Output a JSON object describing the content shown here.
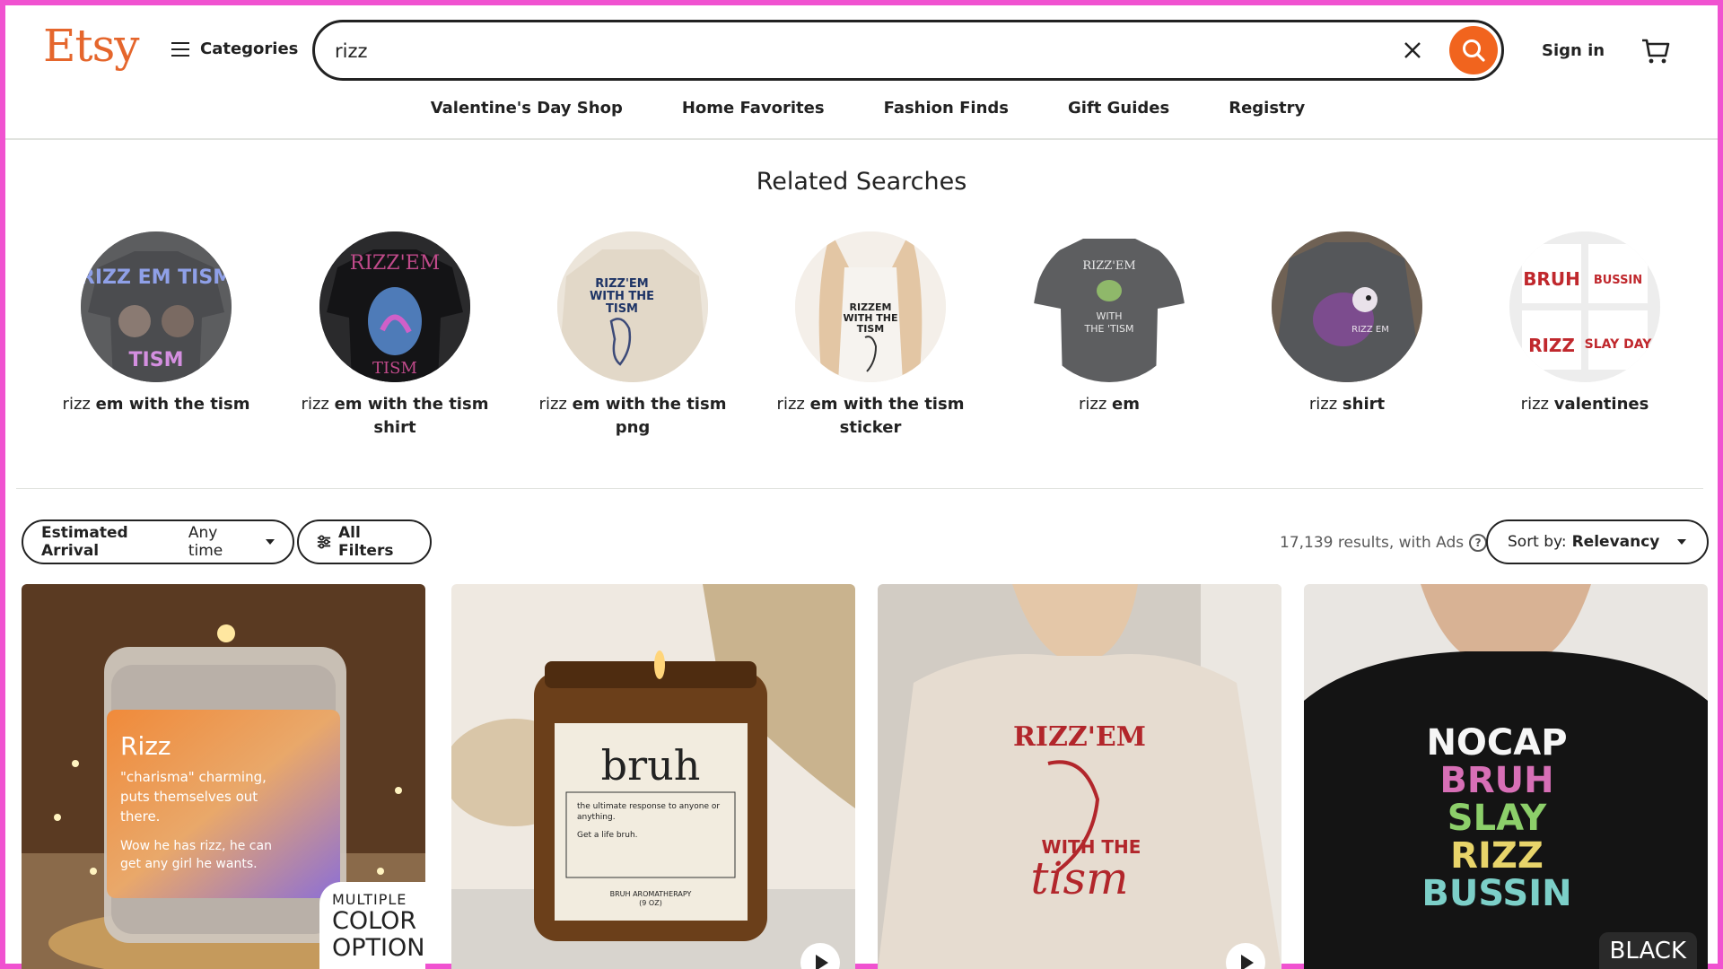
{
  "header": {
    "logo": "Etsy",
    "categories_label": "Categories",
    "search_value": "rizz",
    "signin_label": "Sign in"
  },
  "nav": {
    "items": [
      "Valentine's Day Shop",
      "Home Favorites",
      "Fashion Finds",
      "Gift Guides",
      "Registry"
    ]
  },
  "related": {
    "title": "Related Searches",
    "items": [
      {
        "prefix": "rizz",
        "bold": "em with the tism",
        "line2": "",
        "image_text": "RIZZ EM TISM"
      },
      {
        "prefix": "rizz",
        "bold": "em with the tism",
        "line2": "shirt",
        "image_text": "RIZZ'EM TISM"
      },
      {
        "prefix": "rizz",
        "bold": "em with the tism",
        "line2": "png",
        "image_text": "RIZZ'EM WITH THE TISM"
      },
      {
        "prefix": "rizz",
        "bold": "em with the tism",
        "line2": "sticker",
        "image_text": "RIZZEM WITH THE TISM"
      },
      {
        "prefix": "rizz",
        "bold": "em",
        "line2": "",
        "image_text": "RIZZ'EM WITH THE TISM"
      },
      {
        "prefix": "rizz",
        "bold": "shirt",
        "line2": "",
        "image_text": "RIZZ EM"
      },
      {
        "prefix": "rizz",
        "bold": "valentines",
        "line2": "",
        "image_text": [
          "BRUH",
          "BUSSIN",
          "RIZZ",
          "SLAY DAY"
        ]
      }
    ]
  },
  "filters": {
    "arrival_label": "Estimated Arrival",
    "arrival_value": "Any time",
    "all_filters_label": "All Filters",
    "results_text": "17,139 results, with Ads",
    "help_glyph": "?",
    "sort_label": "Sort by:",
    "sort_value": "Relevancy"
  },
  "listings": [
    {
      "title": "Rizz",
      "lines": [
        "\"charisma\" charming,",
        "puts themselves out",
        "there.",
        "Wow he has rizz, he can",
        "get any girl he wants."
      ],
      "badge_line1": "MULTIPLE",
      "badge_line2": "COLOR",
      "badge_line3": "OPTIONS"
    },
    {
      "title": "bruh",
      "lines": [
        "the ultimate response to anyone or",
        "anything.",
        "Get a life bruh."
      ],
      "footer": "BRUH AROMATHERAPY",
      "footer2": "(9 OZ)"
    },
    {
      "title": "RIZZ'EM",
      "lines": [
        "WITH THE",
        "tism"
      ]
    },
    {
      "title": "NOCAP",
      "lines": [
        "BRUH",
        "SLAY",
        "RIZZ",
        "BUSSIN"
      ],
      "badge": "BLACK"
    }
  ],
  "colors": {
    "brand": "#f1641e",
    "logo": "#e5662c",
    "frame": "#f052d0"
  }
}
